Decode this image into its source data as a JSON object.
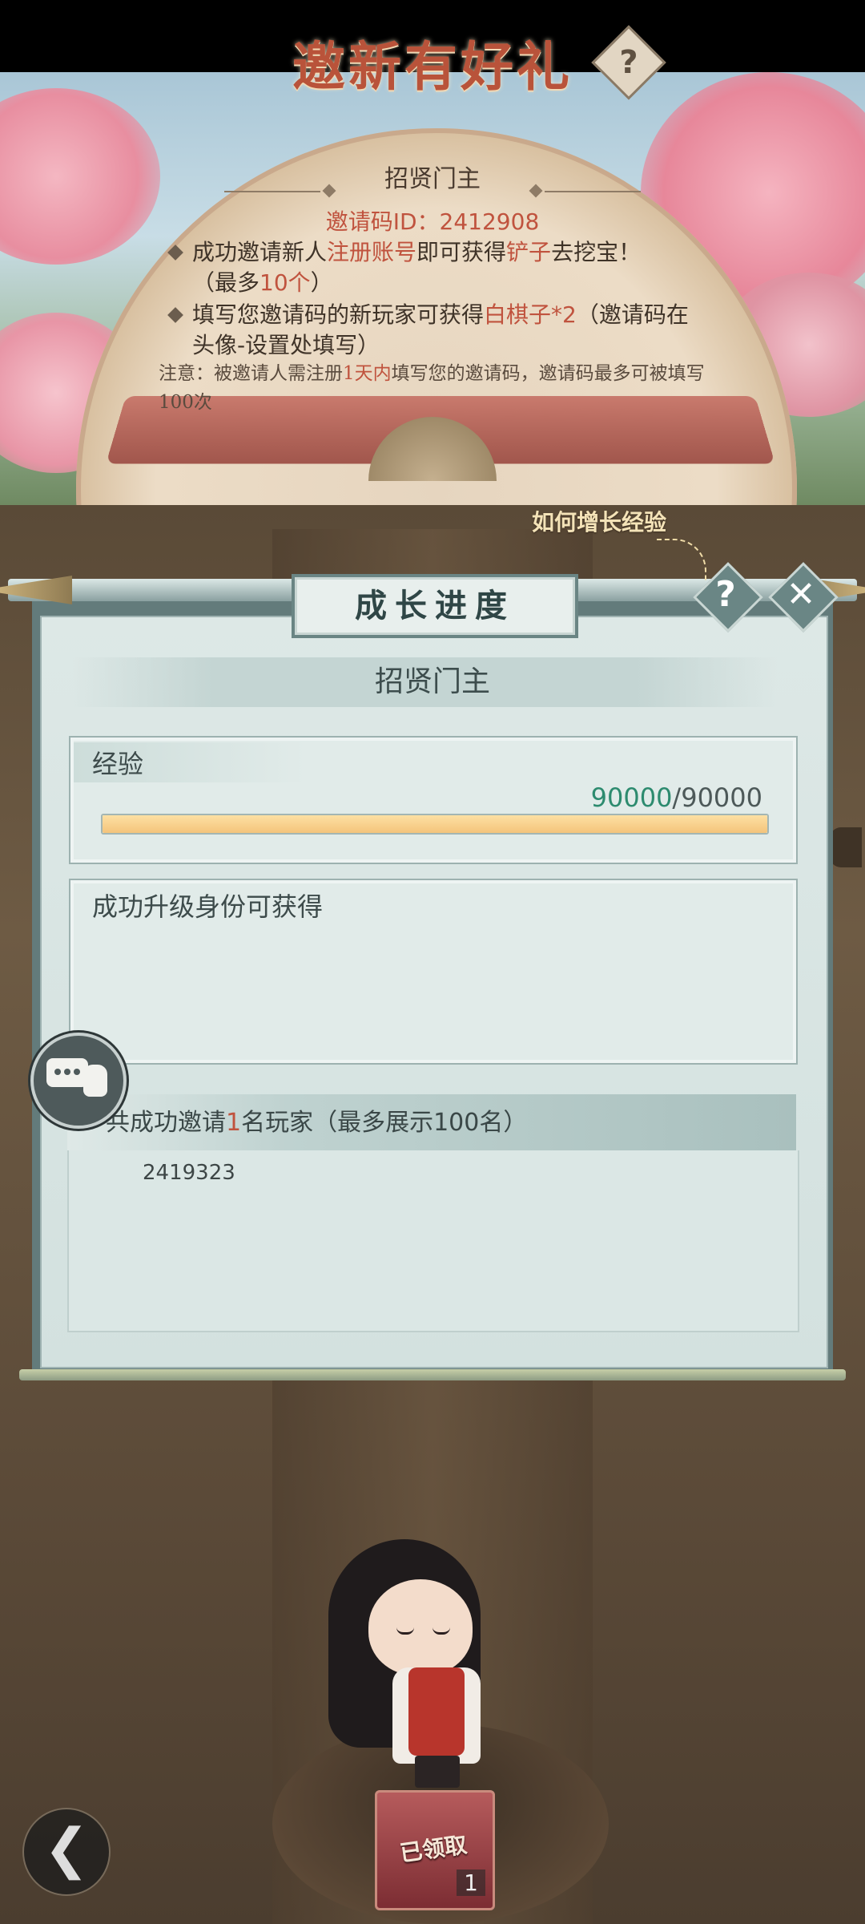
{
  "banner": {
    "title": "邀新有好礼",
    "help_glyph": "?",
    "subtitle": "招贤门主",
    "invite_code": "邀请码ID：2412908",
    "rule1": {
      "part1": "成功邀请新人",
      "highlight1": "注册账号",
      "part2": "即可获得",
      "highlight2": "铲子",
      "part3": "去挖宝！",
      "part4": "（最多",
      "highlight3": "10个",
      "part5": "）"
    },
    "rule2": {
      "part1": "填写您邀请码的新玩家可获得",
      "highlight1": "白棋子*2",
      "part2": "（邀请码在头像-设置处填写）"
    },
    "note": {
      "part1": "注意：被邀请人需注册",
      "highlight": "1天内",
      "part2": "填写您的邀请码，邀请码最多可被填写100次"
    }
  },
  "panel": {
    "title": "成长进度",
    "hint": "如何增长经验",
    "help_glyph": "?",
    "close_glyph": "✕",
    "rank_title": "招贤门主",
    "experience": {
      "label": "经验",
      "current": "90000",
      "separator": "/",
      "max": "90000",
      "progress": 1.0
    },
    "rewards": {
      "label": "成功升级身份可获得"
    },
    "invites": {
      "prefix": "共成功邀请",
      "count": "1",
      "suffix": "名玩家（最多展示100名）",
      "list": [
        "2419323"
      ]
    }
  },
  "bottom": {
    "chest_label": "已领取",
    "chest_count": "1",
    "back_glyph": "❮"
  },
  "colors": {
    "accent_red": "#c0533e",
    "xp_green": "#2d8b6f",
    "panel_teal": "#637b7b",
    "xp_bar": "#f4c47b"
  }
}
